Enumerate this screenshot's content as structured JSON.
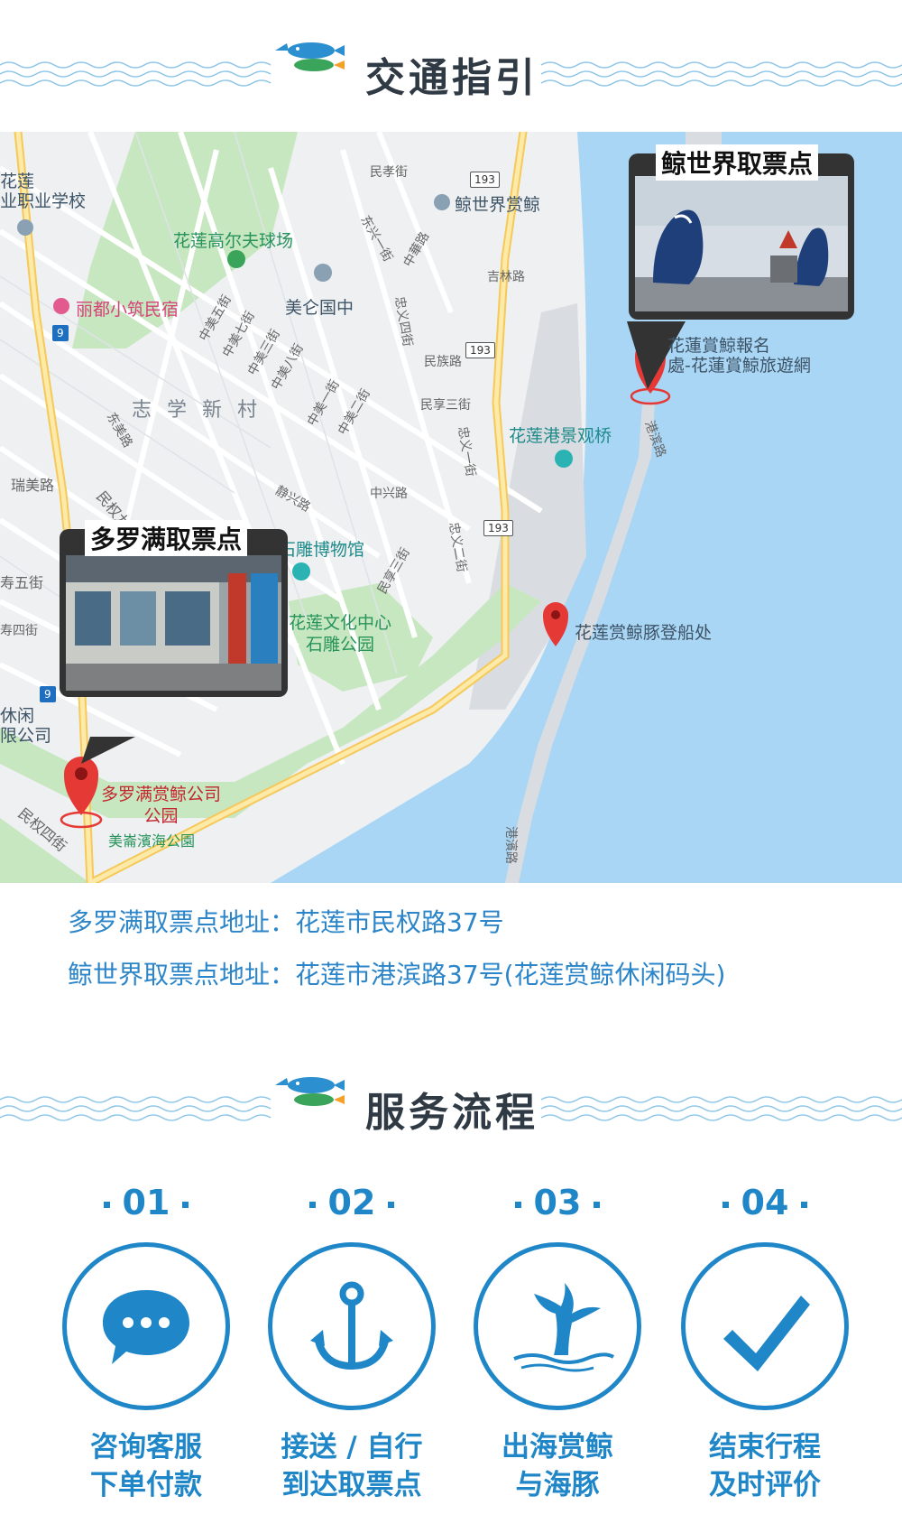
{
  "sections": {
    "transport_title": "交通指引",
    "service_title": "服务流程"
  },
  "map": {
    "labels": {
      "school": "花莲\n业职业学校",
      "whale_world": "鲸世界赏鲸",
      "golf": "花莲高尔夫球场",
      "liduxiaozhu": "丽都小筑民宿",
      "meilun": "美仑国中",
      "zhixue": "志 学 新 村",
      "harbor_bridge": "花莲港景观桥",
      "booking": "花蓮賞鯨報名\n處-花蓮賞鯨旅遊網",
      "stone_museum": "花莲县石雕博物馆",
      "culture_center": "花莲文化中心\n石雕公园",
      "boarding": "花莲赏鲸豚登船处",
      "duoluoman_pin": "多罗满赏鲸公司\n公园",
      "meilun_park": "美崙濱海公園",
      "xiuxian": "休闲\n限公司",
      "roads": {
        "minxiao": "民孝街",
        "jilin": "吉林路",
        "zhonghua": "中華路",
        "dongxing": "东兴一街",
        "zhongmei5": "中美五街",
        "zhongmei7": "中美七街",
        "zhongmei3": "中美三街",
        "zhongmei8": "中美八街",
        "zhongmei1": "中美一街",
        "zhongmei2": "中美二街",
        "zhongyi4": "忠义四街",
        "minzu": "民族路",
        "minxiao3": "民享三街",
        "zhongyi1": "忠义一街",
        "zhongxing": "中兴路",
        "jingxing": "静兴路",
        "minquan9": "民权九街",
        "ruimei": "瑞美路",
        "dongmei": "东美路",
        "shou5": "寿五街",
        "shou4": "寿四街",
        "minsan": "民享三街",
        "zhongyi2": "忠义二街",
        "minquan4": "民权四街",
        "gangbin": "港滨路",
        "gangbin2": "港濱路"
      },
      "shields": [
        "193",
        "193",
        "193",
        "9",
        "9"
      ]
    },
    "callouts": {
      "duoluoman": "多罗满取票点",
      "jingshijie": "鲸世界取票点"
    },
    "colors": {
      "sea": "#a9d6f5",
      "land": "#eef0f2",
      "park": "#c7e7c0",
      "road_major": "#fbe29a",
      "pin": "#e53935"
    }
  },
  "addresses": {
    "duoluoman": "多罗满取票点地址：花莲市民权路37号",
    "jingshijie": "鲸世界取票点地址：花莲市港滨路37号(花莲赏鲸休闲码头)"
  },
  "steps": [
    {
      "num": "01",
      "line1": "咨询客服",
      "line2": "下单付款",
      "icon": "chat-bubble-icon"
    },
    {
      "num": "02",
      "line1": "接送 / 自行",
      "line2": "到达取票点",
      "icon": "anchor-icon"
    },
    {
      "num": "03",
      "line1": "出海赏鲸",
      "line2": "与海豚",
      "icon": "whale-tail-icon"
    },
    {
      "num": "04",
      "line1": "结束行程",
      "line2": "及时评价",
      "icon": "checkmark-icon"
    }
  ],
  "accent_color": "#1f86c8"
}
